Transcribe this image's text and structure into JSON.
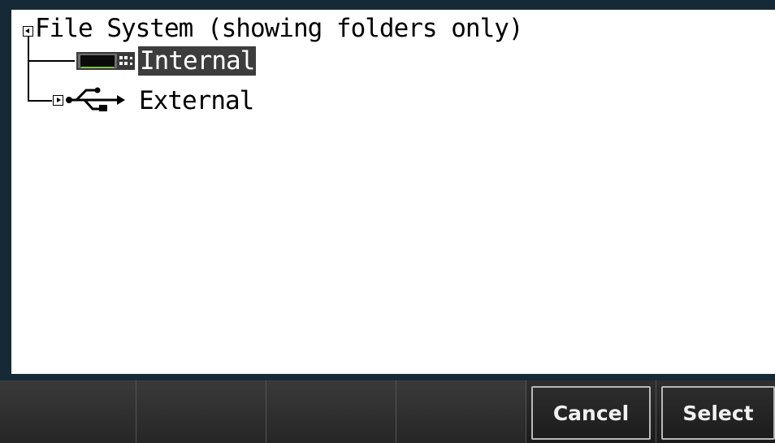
{
  "tree": {
    "root": {
      "label": "File System (showing folders only)",
      "icon": "collapse-icon",
      "expanded": true
    },
    "children": [
      {
        "label": "Internal",
        "icon": "instrument-icon",
        "selected": true
      },
      {
        "label": "External",
        "icon": "usb-icon",
        "expander_icon": "expand-icon",
        "expanded": false
      }
    ]
  },
  "softkeys": {
    "key1": "",
    "key2": "",
    "key3": "",
    "key4": "",
    "cancel": "Cancel",
    "select": "Select"
  },
  "colors": {
    "frame": "#152a36",
    "selection": "#3d3d3d",
    "softkey_text": "#f0f0f0"
  }
}
